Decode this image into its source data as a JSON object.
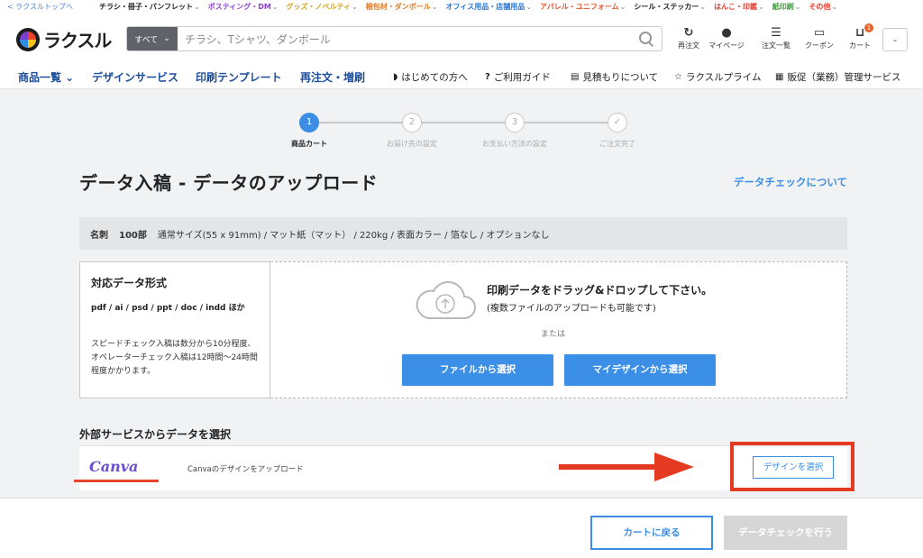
{
  "topbar": {
    "back_link": "< ラクスルトップへ",
    "categories": [
      {
        "label": "チラシ・冊子・パンフレット",
        "color": "#222222"
      },
      {
        "label": "ポスティング・DM",
        "color": "#8a3fd0"
      },
      {
        "label": "グッズ・ノベルティ",
        "color": "#d6a21b"
      },
      {
        "label": "梱包材・ダンボール",
        "color": "#e07a1f"
      },
      {
        "label": "オフィス用品・店舗用品",
        "color": "#1f76d6"
      },
      {
        "label": "アパレル・ユニフォーム",
        "color": "#e5532a"
      },
      {
        "label": "シール・ステッカー",
        "color": "#222222"
      },
      {
        "label": "はんこ・印鑑",
        "color": "#e23c2f"
      },
      {
        "label": "紙印刷",
        "color": "#3a9a3a"
      },
      {
        "label": "その他",
        "color": "#e23c2f"
      }
    ]
  },
  "header": {
    "logo": "ラクスル",
    "search_scope": "すべて",
    "search_placeholder": "チラシ、Tシャツ、ダンボール",
    "icons": [
      {
        "label": "再注文",
        "icon": "reorder-icon",
        "glyph": "↻"
      },
      {
        "label": "マイページ",
        "icon": "user-icon",
        "glyph": "●"
      },
      {
        "label": "注文一覧",
        "icon": "list-icon",
        "glyph": "☰"
      },
      {
        "label": "クーポン",
        "icon": "coupon-icon",
        "glyph": "▭"
      },
      {
        "label": "カート",
        "icon": "cart-icon",
        "glyph": "⊔"
      }
    ],
    "cart_count": "1",
    "account_chevron": "⌄"
  },
  "nav": {
    "main": [
      "商品一覧 ⌄",
      "デザインサービス",
      "印刷テンプレート",
      "再注文・増刷"
    ],
    "sub": [
      {
        "label": "はじめての方へ",
        "icon": "shield-icon",
        "glyph": "◗"
      },
      {
        "label": "ご利用ガイド",
        "icon": "help-icon",
        "glyph": "?"
      },
      {
        "label": "見積もりについて",
        "icon": "calculator-icon",
        "glyph": "▤"
      },
      {
        "label": "ラクスルプライム",
        "icon": "star-icon",
        "glyph": "☆"
      },
      {
        "label": "販促（業務）管理サービス",
        "icon": "building-icon",
        "glyph": "▦"
      }
    ]
  },
  "steps": [
    {
      "num": "1",
      "label": "商品カート",
      "active": true
    },
    {
      "num": "2",
      "label": "お届け先の設定",
      "active": false
    },
    {
      "num": "3",
      "label": "お支払い方法の設定",
      "active": false
    },
    {
      "num": "✓",
      "label": "ご注文完了",
      "active": false
    }
  ],
  "page": {
    "title": "データ入稿 - データのアップロード",
    "about_link": "データチェックについて"
  },
  "spec": {
    "product": "名刺",
    "quantity": "100部",
    "details": "通常サイズ(55 x 91mm) / マット紙（マット） / 220kg / 表面カラー / 箔なし / オプションなし"
  },
  "formats": {
    "title": "対応データ形式",
    "types": "pdf / ai / psd / ppt / doc / indd ほか",
    "note": "スピードチェック入稿は数分から10分程度、オペレーターチェック入稿は12時間〜24時間程度かかります。"
  },
  "dropzone": {
    "message": "印刷データをドラッグ&ドロップして下さい。",
    "sub_message": "(複数ファイルのアップロードも可能です)",
    "or": "または",
    "file_button": "ファイルから選択",
    "mydesign_button": "マイデザインから選択"
  },
  "external": {
    "title": "外部サービスからデータを選択",
    "canva_logo": "Canva",
    "canva_desc": "Canvaのデザインをアップロード",
    "select_button": "デザインを選択"
  },
  "footer": {
    "back_button": "カートに戻る",
    "check_button": "データチェックを行う"
  },
  "colors": {
    "accent": "#3b8ee3",
    "highlight": "#e43a21",
    "canva": "#6a4fd3"
  }
}
